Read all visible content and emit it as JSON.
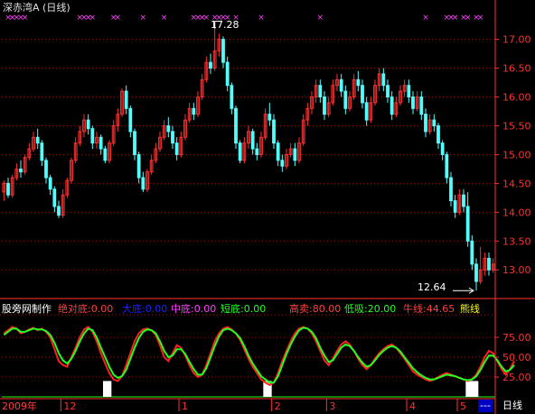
{
  "header": {
    "stock_name": "深赤湾A",
    "period_label": "(日线)"
  },
  "price_panel": {
    "y_ticks": [
      "17.00",
      "16.50",
      "16.00",
      "15.50",
      "15.00",
      "14.50",
      "14.00",
      "13.50",
      "13.00"
    ],
    "high_label": "17.28",
    "low_label": "12.64",
    "candles": [
      [
        14.35,
        14.5,
        14.55,
        14.2
      ],
      [
        14.5,
        14.3,
        14.6,
        14.25
      ],
      [
        14.3,
        14.6,
        14.65,
        14.25
      ],
      [
        14.6,
        14.75,
        14.85,
        14.55
      ],
      [
        14.75,
        14.7,
        14.9,
        14.6
      ],
      [
        14.7,
        14.95,
        15.0,
        14.65
      ],
      [
        14.95,
        15.1,
        15.2,
        14.9
      ],
      [
        15.1,
        15.3,
        15.4,
        15.05
      ],
      [
        15.3,
        15.2,
        15.45,
        15.1
      ],
      [
        15.2,
        14.9,
        15.25,
        14.8
      ],
      [
        14.9,
        14.6,
        14.95,
        14.5
      ],
      [
        14.6,
        14.4,
        14.65,
        14.3
      ],
      [
        14.4,
        14.1,
        14.45,
        14.0
      ],
      [
        14.1,
        13.95,
        14.2,
        13.9
      ],
      [
        13.95,
        14.3,
        14.4,
        13.9
      ],
      [
        14.3,
        14.55,
        14.6,
        14.25
      ],
      [
        14.55,
        14.9,
        14.95,
        14.5
      ],
      [
        14.9,
        15.2,
        15.3,
        14.85
      ],
      [
        15.2,
        15.4,
        15.5,
        15.15
      ],
      [
        15.4,
        15.6,
        15.7,
        15.3
      ],
      [
        15.6,
        15.45,
        15.7,
        15.35
      ],
      [
        15.45,
        15.2,
        15.5,
        15.1
      ],
      [
        15.2,
        15.3,
        15.4,
        15.1
      ],
      [
        15.3,
        15.1,
        15.35,
        15.0
      ],
      [
        15.1,
        14.9,
        15.15,
        14.85
      ],
      [
        14.9,
        15.2,
        15.25,
        14.85
      ],
      [
        15.2,
        15.5,
        15.6,
        15.15
      ],
      [
        15.5,
        15.7,
        15.8,
        15.4
      ],
      [
        15.7,
        16.1,
        16.15,
        15.65
      ],
      [
        16.1,
        15.8,
        16.2,
        15.7
      ],
      [
        15.8,
        15.4,
        15.85,
        15.3
      ],
      [
        15.4,
        15.0,
        15.45,
        14.9
      ],
      [
        15.0,
        14.6,
        15.05,
        14.5
      ],
      [
        14.6,
        14.4,
        14.7,
        14.35
      ],
      [
        14.4,
        14.7,
        14.75,
        14.35
      ],
      [
        14.7,
        14.9,
        15.0,
        14.65
      ],
      [
        14.9,
        15.1,
        15.2,
        14.85
      ],
      [
        15.1,
        15.3,
        15.4,
        15.05
      ],
      [
        15.3,
        15.5,
        15.6,
        15.25
      ],
      [
        15.5,
        15.4,
        15.65,
        15.3
      ],
      [
        15.4,
        15.2,
        15.5,
        15.1
      ],
      [
        15.2,
        15.0,
        15.3,
        14.9
      ],
      [
        15.0,
        15.3,
        15.4,
        14.95
      ],
      [
        15.3,
        15.6,
        15.7,
        15.25
      ],
      [
        15.6,
        15.8,
        15.9,
        15.55
      ],
      [
        15.8,
        15.7,
        15.9,
        15.6
      ],
      [
        15.7,
        16.0,
        16.1,
        15.65
      ],
      [
        16.0,
        16.3,
        16.4,
        15.95
      ],
      [
        16.3,
        16.6,
        16.7,
        16.25
      ],
      [
        16.6,
        16.5,
        16.75,
        16.4
      ],
      [
        16.5,
        16.8,
        17.28,
        16.45
      ],
      [
        16.8,
        17.0,
        17.1,
        16.7
      ],
      [
        17.0,
        16.6,
        17.05,
        16.5
      ],
      [
        16.6,
        16.2,
        16.7,
        16.1
      ],
      [
        16.2,
        15.8,
        16.25,
        15.7
      ],
      [
        15.8,
        15.2,
        15.85,
        15.1
      ],
      [
        15.2,
        14.9,
        15.25,
        14.85
      ],
      [
        14.9,
        15.2,
        15.3,
        14.85
      ],
      [
        15.2,
        15.4,
        15.5,
        15.1
      ],
      [
        15.4,
        15.1,
        15.45,
        15.0
      ],
      [
        15.1,
        15.0,
        15.2,
        14.9
      ],
      [
        15.0,
        15.3,
        15.4,
        14.95
      ],
      [
        15.3,
        15.7,
        15.8,
        15.25
      ],
      [
        15.7,
        15.6,
        15.9,
        15.5
      ],
      [
        15.6,
        15.2,
        15.7,
        15.1
      ],
      [
        15.2,
        14.9,
        15.25,
        14.8
      ],
      [
        14.9,
        14.8,
        15.0,
        14.7
      ],
      [
        14.8,
        15.0,
        15.1,
        14.75
      ],
      [
        15.0,
        15.1,
        15.2,
        14.95
      ],
      [
        15.1,
        14.9,
        15.2,
        14.8
      ],
      [
        14.9,
        15.2,
        15.3,
        14.85
      ],
      [
        15.2,
        15.6,
        15.7,
        15.15
      ],
      [
        15.6,
        15.8,
        15.9,
        15.5
      ],
      [
        15.8,
        16.0,
        16.1,
        15.7
      ],
      [
        16.0,
        16.2,
        16.3,
        15.9
      ],
      [
        16.2,
        16.0,
        16.3,
        15.9
      ],
      [
        16.0,
        15.7,
        16.1,
        15.6
      ],
      [
        15.7,
        15.9,
        16.0,
        15.65
      ],
      [
        15.9,
        16.2,
        16.3,
        15.85
      ],
      [
        16.2,
        16.3,
        16.4,
        16.1
      ],
      [
        16.3,
        16.1,
        16.4,
        16.0
      ],
      [
        16.1,
        15.8,
        16.2,
        15.7
      ],
      [
        15.8,
        16.0,
        16.1,
        15.75
      ],
      [
        16.0,
        16.3,
        16.4,
        15.95
      ],
      [
        16.3,
        16.2,
        16.45,
        16.1
      ],
      [
        16.2,
        15.9,
        16.3,
        15.8
      ],
      [
        15.9,
        15.6,
        16.0,
        15.5
      ],
      [
        15.6,
        15.9,
        16.0,
        15.55
      ],
      [
        15.9,
        16.2,
        16.3,
        15.85
      ],
      [
        16.2,
        16.4,
        16.5,
        16.1
      ],
      [
        16.4,
        16.2,
        16.5,
        16.1
      ],
      [
        16.2,
        16.0,
        16.3,
        15.9
      ],
      [
        16.0,
        15.7,
        16.1,
        15.6
      ],
      [
        15.7,
        15.9,
        16.0,
        15.65
      ],
      [
        15.9,
        16.1,
        16.2,
        15.85
      ],
      [
        16.1,
        16.2,
        16.3,
        16.0
      ],
      [
        16.2,
        16.0,
        16.3,
        15.9
      ],
      [
        16.0,
        15.8,
        16.1,
        15.7
      ],
      [
        15.8,
        16.0,
        16.1,
        15.75
      ],
      [
        16.0,
        15.7,
        16.1,
        15.6
      ],
      [
        15.7,
        15.4,
        15.8,
        15.3
      ],
      [
        15.4,
        15.6,
        15.7,
        15.35
      ],
      [
        15.6,
        15.5,
        15.7,
        15.4
      ],
      [
        15.5,
        15.2,
        15.55,
        15.1
      ],
      [
        15.2,
        15.0,
        15.25,
        14.9
      ],
      [
        15.0,
        14.6,
        15.05,
        14.5
      ],
      [
        14.6,
        14.2,
        14.7,
        14.1
      ],
      [
        14.2,
        14.0,
        14.3,
        13.9
      ],
      [
        14.0,
        14.3,
        14.4,
        13.95
      ],
      [
        14.3,
        14.1,
        14.4,
        14.0
      ],
      [
        14.1,
        13.5,
        14.35,
        13.4
      ],
      [
        13.5,
        13.1,
        13.6,
        13.0
      ],
      [
        13.1,
        12.8,
        13.2,
        12.64
      ],
      [
        12.8,
        13.0,
        13.4,
        12.75
      ],
      [
        13.0,
        13.2,
        13.3,
        12.9
      ],
      [
        13.2,
        13.0,
        13.3,
        12.9
      ],
      [
        13.0,
        13.1,
        13.2,
        12.95
      ]
    ],
    "colors": {
      "up": "#ff3030",
      "down": "#54fcfc",
      "axis": "#ff3030",
      "grid": "#8a1a1a"
    }
  },
  "indicator": {
    "title": "股旁网制作",
    "labels": [
      {
        "text": "绝对底:0.00",
        "color": "#ff4040"
      },
      {
        "text": "大底:0.00",
        "color": "#2020ff"
      },
      {
        "text": "中底:0.00",
        "color": "#ff40ff"
      },
      {
        "text": "短底:0.00",
        "color": "#20ff20"
      },
      {
        "text": "高卖:80.00",
        "color": "#ff4040"
      },
      {
        "text": "低吸:20.00",
        "color": "#20ff20"
      },
      {
        "text": "牛线:44.65",
        "color": "#ff4040"
      },
      {
        "text": "熊线",
        "color": "#ffff00"
      }
    ],
    "y_ticks": [
      "75.00",
      "50.00",
      "25.00"
    ],
    "red_line": [
      80,
      84,
      88,
      86,
      80,
      82,
      85,
      87,
      84,
      86,
      82,
      75,
      60,
      45,
      40,
      38,
      50,
      62,
      75,
      85,
      88,
      82,
      70,
      55,
      42,
      30,
      22,
      20,
      26,
      40,
      55,
      70,
      80,
      85,
      86,
      84,
      78,
      65,
      50,
      45,
      55,
      65,
      62,
      52,
      40,
      30,
      25,
      28,
      40,
      55,
      70,
      80,
      86,
      88,
      85,
      80,
      72,
      60,
      48,
      38,
      30,
      22,
      18,
      15,
      18,
      30,
      45,
      58,
      70,
      80,
      86,
      88,
      86,
      80,
      70,
      58,
      46,
      40,
      48,
      58,
      66,
      70,
      66,
      58,
      48,
      40,
      35,
      40,
      48,
      55,
      60,
      64,
      66,
      62,
      55,
      48,
      40,
      32,
      28,
      25,
      22,
      20,
      22,
      25,
      28,
      30,
      28,
      26,
      24,
      22,
      20,
      22,
      28,
      38,
      50,
      58,
      55,
      45,
      35,
      28,
      35,
      45
    ],
    "green_line": [
      78,
      82,
      86,
      86,
      82,
      82,
      84,
      86,
      85,
      85,
      83,
      78,
      68,
      55,
      46,
      42,
      48,
      58,
      70,
      80,
      86,
      84,
      75,
      62,
      50,
      38,
      28,
      24,
      26,
      34,
      48,
      62,
      74,
      82,
      85,
      84,
      80,
      70,
      58,
      50,
      52,
      60,
      60,
      54,
      44,
      35,
      28,
      28,
      36,
      50,
      64,
      76,
      84,
      86,
      84,
      80,
      74,
      64,
      52,
      42,
      34,
      26,
      22,
      18,
      18,
      26,
      40,
      54,
      66,
      76,
      84,
      87,
      86,
      82,
      74,
      62,
      52,
      44,
      46,
      54,
      62,
      66,
      64,
      58,
      50,
      43,
      38,
      40,
      46,
      53,
      58,
      62,
      64,
      62,
      57,
      50,
      43,
      36,
      31,
      27,
      24,
      22,
      22,
      24,
      26,
      28,
      27,
      26,
      24,
      22,
      21,
      22,
      26,
      34,
      44,
      52,
      52,
      46,
      38,
      32,
      34,
      40
    ],
    "white_bars": [
      [
        24,
        25
      ],
      [
        62,
        63
      ],
      [
        110,
        112
      ]
    ],
    "colors": {
      "red": "#ff2020",
      "green": "#20ff20",
      "white": "#ffffff"
    }
  },
  "time_axis": {
    "year_label": "2009年",
    "months": [
      {
        "label": "12",
        "idx": 14
      },
      {
        "label": "1",
        "idx": 42
      },
      {
        "label": "2",
        "idx": 64
      },
      {
        "label": "3",
        "idx": 77
      },
      {
        "label": "4",
        "idx": 96
      },
      {
        "label": "5",
        "idx": 108
      }
    ],
    "buttons": {
      "more": "---",
      "period": "日线"
    }
  },
  "markers": {
    "color": "#ff40ff",
    "positions": [
      1,
      2,
      3,
      4,
      5,
      18,
      19,
      20,
      21,
      26,
      27,
      33,
      38,
      45,
      46,
      47,
      48,
      50,
      51,
      52,
      53,
      55,
      61,
      75,
      100,
      105,
      106,
      107,
      109,
      110,
      112,
      113
    ]
  }
}
